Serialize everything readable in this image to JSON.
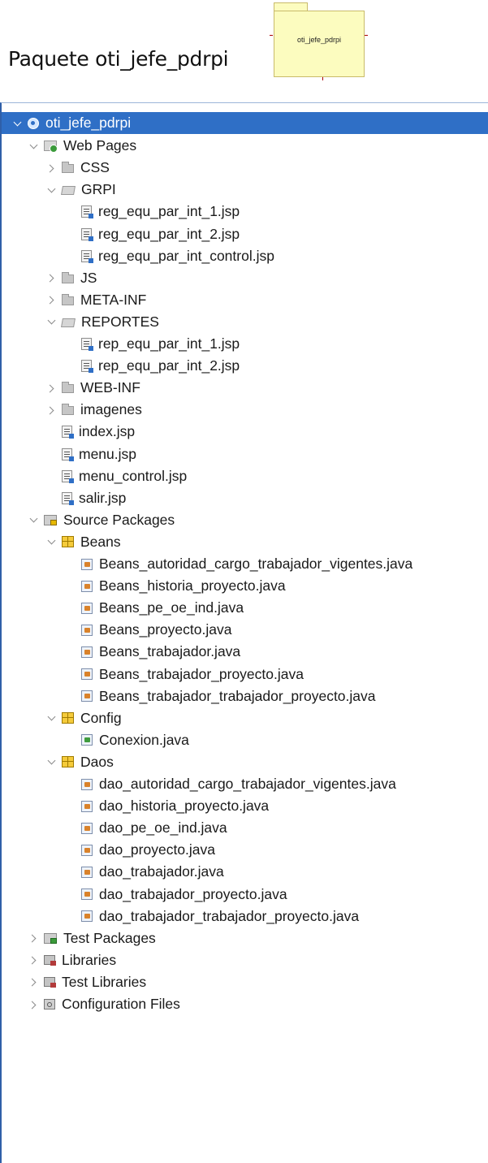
{
  "heading": "Paquete oti_jefe_pdrpi",
  "package_box": {
    "label": "oti_jefe_pdrpi",
    "fill": "#fcfcbf"
  },
  "selection_color": "#2f6fc6",
  "tree": [
    {
      "label": "oti_jefe_pdrpi",
      "level": 0,
      "chevron": "down",
      "icon": "project-globe-icon",
      "selected": true
    },
    {
      "label": "Web Pages",
      "level": 1,
      "chevron": "down",
      "icon": "web-pages-icon"
    },
    {
      "label": "CSS",
      "level": 2,
      "chevron": "right",
      "icon": "folder-icon"
    },
    {
      "label": "GRPI",
      "level": 2,
      "chevron": "down",
      "icon": "folder-open-icon"
    },
    {
      "label": "reg_equ_par_int_1.jsp",
      "level": 3,
      "chevron": "none",
      "icon": "jsp-file-icon"
    },
    {
      "label": "reg_equ_par_int_2.jsp",
      "level": 3,
      "chevron": "none",
      "icon": "jsp-file-icon"
    },
    {
      "label": "reg_equ_par_int_control.jsp",
      "level": 3,
      "chevron": "none",
      "icon": "jsp-file-icon"
    },
    {
      "label": "JS",
      "level": 2,
      "chevron": "right",
      "icon": "folder-icon"
    },
    {
      "label": "META-INF",
      "level": 2,
      "chevron": "right",
      "icon": "folder-icon"
    },
    {
      "label": "REPORTES",
      "level": 2,
      "chevron": "down",
      "icon": "folder-open-icon"
    },
    {
      "label": "rep_equ_par_int_1.jsp",
      "level": 3,
      "chevron": "none",
      "icon": "jsp-file-icon"
    },
    {
      "label": "rep_equ_par_int_2.jsp",
      "level": 3,
      "chevron": "none",
      "icon": "jsp-file-icon"
    },
    {
      "label": "WEB-INF",
      "level": 2,
      "chevron": "right",
      "icon": "folder-icon"
    },
    {
      "label": "imagenes",
      "level": 2,
      "chevron": "right",
      "icon": "folder-icon"
    },
    {
      "label": "index.jsp",
      "level": 2,
      "chevron": "none",
      "icon": "jsp-file-icon"
    },
    {
      "label": "menu.jsp",
      "level": 2,
      "chevron": "none",
      "icon": "jsp-file-icon"
    },
    {
      "label": "menu_control.jsp",
      "level": 2,
      "chevron": "none",
      "icon": "jsp-file-icon"
    },
    {
      "label": "salir.jsp",
      "level": 2,
      "chevron": "none",
      "icon": "jsp-file-icon"
    },
    {
      "label": "Source Packages",
      "level": 1,
      "chevron": "down",
      "icon": "source-packages-icon"
    },
    {
      "label": "Beans",
      "level": 2,
      "chevron": "down",
      "icon": "package-icon"
    },
    {
      "label": "Beans_autoridad_cargo_trabajador_vigentes.java",
      "level": 3,
      "chevron": "none",
      "icon": "java-file-icon"
    },
    {
      "label": "Beans_historia_proyecto.java",
      "level": 3,
      "chevron": "none",
      "icon": "java-file-icon"
    },
    {
      "label": "Beans_pe_oe_ind.java",
      "level": 3,
      "chevron": "none",
      "icon": "java-file-icon"
    },
    {
      "label": "Beans_proyecto.java",
      "level": 3,
      "chevron": "none",
      "icon": "java-file-icon"
    },
    {
      "label": "Beans_trabajador.java",
      "level": 3,
      "chevron": "none",
      "icon": "java-file-icon"
    },
    {
      "label": "Beans_trabajador_proyecto.java",
      "level": 3,
      "chevron": "none",
      "icon": "java-file-icon"
    },
    {
      "label": "Beans_trabajador_trabajador_proyecto.java",
      "level": 3,
      "chevron": "none",
      "icon": "java-file-icon"
    },
    {
      "label": "Config",
      "level": 2,
      "chevron": "down",
      "icon": "package-icon"
    },
    {
      "label": "Conexion.java",
      "level": 3,
      "chevron": "none",
      "icon": "java-main-file-icon"
    },
    {
      "label": "Daos",
      "level": 2,
      "chevron": "down",
      "icon": "package-icon"
    },
    {
      "label": "dao_autoridad_cargo_trabajador_vigentes.java",
      "level": 3,
      "chevron": "none",
      "icon": "java-file-icon"
    },
    {
      "label": "dao_historia_proyecto.java",
      "level": 3,
      "chevron": "none",
      "icon": "java-file-icon"
    },
    {
      "label": "dao_pe_oe_ind.java",
      "level": 3,
      "chevron": "none",
      "icon": "java-file-icon"
    },
    {
      "label": "dao_proyecto.java",
      "level": 3,
      "chevron": "none",
      "icon": "java-file-icon"
    },
    {
      "label": "dao_trabajador.java",
      "level": 3,
      "chevron": "none",
      "icon": "java-file-icon"
    },
    {
      "label": "dao_trabajador_proyecto.java",
      "level": 3,
      "chevron": "none",
      "icon": "java-file-icon"
    },
    {
      "label": "dao_trabajador_trabajador_proyecto.java",
      "level": 3,
      "chevron": "none",
      "icon": "java-file-icon"
    },
    {
      "label": "Test Packages",
      "level": 1,
      "chevron": "right",
      "icon": "test-packages-icon"
    },
    {
      "label": "Libraries",
      "level": 1,
      "chevron": "right",
      "icon": "libraries-icon"
    },
    {
      "label": "Test Libraries",
      "level": 1,
      "chevron": "right",
      "icon": "test-libraries-icon"
    },
    {
      "label": "Configuration Files",
      "level": 1,
      "chevron": "right",
      "icon": "configuration-files-icon"
    }
  ]
}
